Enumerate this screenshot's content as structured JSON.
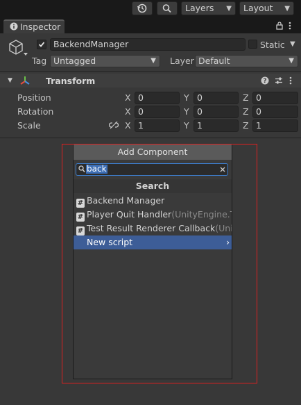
{
  "toolbar": {
    "layers_label": "Layers",
    "layout_label": "Layout"
  },
  "tab": {
    "title": "Inspector"
  },
  "object": {
    "name": "BackendManager",
    "static_label": "Static",
    "tag_label": "Tag",
    "tag_value": "Untagged",
    "layer_label": "Layer",
    "layer_value": "Default"
  },
  "transform": {
    "title": "Transform",
    "rows": [
      {
        "label": "Position",
        "x": "0",
        "y": "0",
        "z": "0"
      },
      {
        "label": "Rotation",
        "x": "0",
        "y": "0",
        "z": "0"
      },
      {
        "label": "Scale",
        "x": "1",
        "y": "1",
        "z": "1"
      }
    ],
    "axis_x": "X",
    "axis_y": "Y",
    "axis_z": "Z"
  },
  "popup": {
    "header": "Add Component",
    "search_value": "back",
    "results_title": "Search",
    "results": [
      {
        "name": "Backend Manager",
        "ns": ""
      },
      {
        "name": "Player Quit Handler",
        "ns": "(UnityEngine.Test"
      },
      {
        "name": "Test Result Renderer Callback",
        "ns": "(UnityE"
      }
    ],
    "new_script_label": "New script"
  },
  "colors": {
    "accent": "#3d5d97",
    "highlight": "#e02020",
    "panel": "#383838"
  },
  "icons": [
    "history-icon",
    "search-icon",
    "info-icon",
    "lock-icon",
    "menu-icon",
    "cube-icon",
    "checkbox-icon",
    "transform-icon",
    "help-icon",
    "preset-icon",
    "kebab-icon",
    "constrain-link-icon",
    "clear-search-icon",
    "script-icon",
    "chevron-right-icon"
  ]
}
